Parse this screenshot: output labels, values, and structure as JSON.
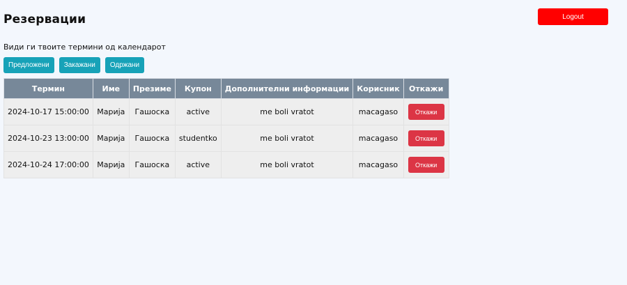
{
  "header": {
    "title": "Резервации",
    "logout_label": "Logout"
  },
  "subtitle": "Види ги твоите термини од календарот",
  "filters": [
    {
      "label": "Предложени"
    },
    {
      "label": "Закажани"
    },
    {
      "label": "Одржани"
    }
  ],
  "table": {
    "headers": {
      "term": "Термин",
      "name": "Име",
      "surname": "Презиме",
      "coupon": "Купон",
      "info": "Дополнителни информации",
      "user": "Корисник",
      "cancel": "Откажи"
    },
    "rows": [
      {
        "term": "2024-10-17 15:00:00",
        "name": "Марија",
        "surname": "Гашоска",
        "coupon": "active",
        "info": "me boli vratot",
        "user": "macagaso",
        "cancel_label": "Откажи"
      },
      {
        "term": "2024-10-23 13:00:00",
        "name": "Марија",
        "surname": "Гашоска",
        "coupon": "studentko",
        "info": "me boli vratot",
        "user": "macagaso",
        "cancel_label": "Откажи"
      },
      {
        "term": "2024-10-24 17:00:00",
        "name": "Марија",
        "surname": "Гашоска",
        "coupon": "active",
        "info": "me boli vratot",
        "user": "macagaso",
        "cancel_label": "Откажи"
      }
    ]
  },
  "colors": {
    "background": "#f3f7fd",
    "logout": "#ff0000",
    "filter_button": "#17a2b8",
    "table_header": "#778899",
    "cancel_button": "#dc3545"
  }
}
